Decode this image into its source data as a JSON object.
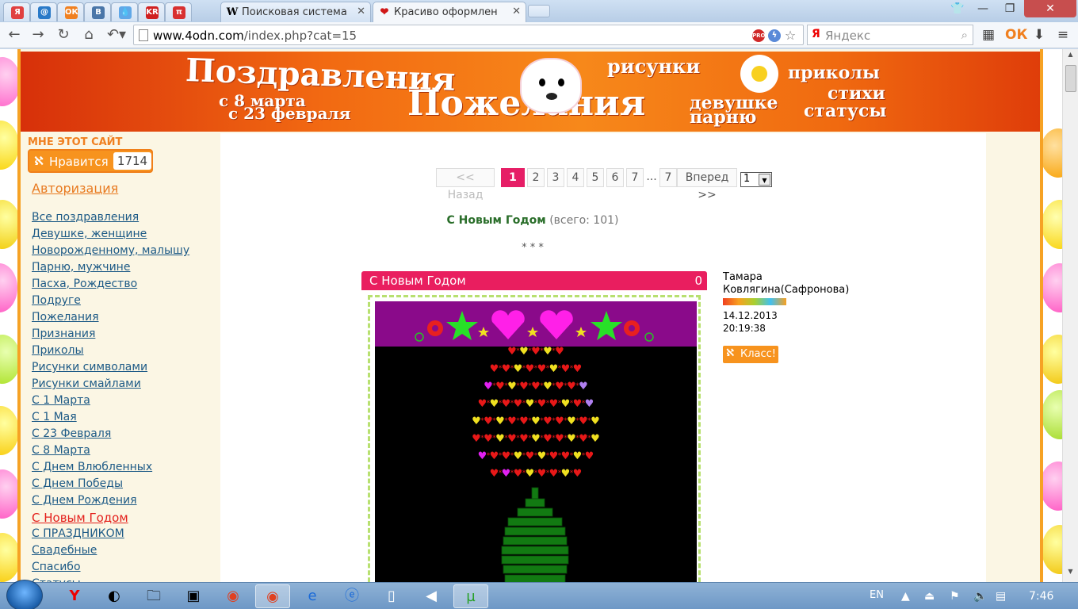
{
  "browser": {
    "pinned_tabs": [
      {
        "icon": "yandex-icon",
        "glyph": "Я",
        "color": "#e04040"
      },
      {
        "icon": "mail-icon",
        "glyph": "@",
        "color": "#2a7ac8"
      },
      {
        "icon": "odnoklassniki-icon",
        "glyph": "ОК",
        "color": "#f08020"
      },
      {
        "icon": "vk-icon",
        "glyph": "В",
        "color": "#4a76a8"
      },
      {
        "icon": "drop-icon",
        "glyph": "💧",
        "color": "#60a8e8"
      },
      {
        "icon": "kr-icon",
        "glyph": "KR",
        "color": "#d02020"
      },
      {
        "icon": "pi-icon",
        "glyph": "π",
        "color": "#d83030"
      }
    ],
    "tabs": [
      {
        "title": "Поисковая система",
        "favicon": "W",
        "active": false
      },
      {
        "title": "Красиво оформлен",
        "favicon": "❤",
        "active": true
      }
    ],
    "url_domain": "www.4odn.com",
    "url_path": "/index.php?cat=15",
    "search_placeholder": "Яндекс"
  },
  "site": {
    "banner": {
      "title1": "Поздравления",
      "subtitle1": "с 8 марта",
      "subtitle2": "с 23 февраля",
      "title2": "Пожелания",
      "words": [
        "рисунки",
        "приколы",
        "девушке",
        "стихи",
        "парню",
        "статусы"
      ]
    },
    "like_caption": "МНЕ ЭТОТ САЙТ",
    "like_label": "Нравится",
    "like_count": "1714",
    "auth_link": "Авторизация",
    "menu": [
      "Все поздравления",
      "Девушке, женщине",
      "Новорожденному, малышу",
      "Парню, мужчине",
      "Пасха, Рождество",
      "Подруге",
      "Пожелания",
      "Признания",
      "Приколы",
      "Рисунки символами",
      "Рисунки смайлами",
      "С 1 Марта",
      "С 1 Мая",
      "С 23 Февраля",
      "С 8 Марта",
      "С Днем Влюбленных",
      "С Днем Победы",
      "С Днем Рождения",
      "С Новым Годом",
      "С ПРАЗДНИКОМ",
      "Свадебные",
      "Спасибо",
      "Статусы"
    ],
    "menu_current_index": 18,
    "pager": {
      "prev": "<< Назад",
      "pages": [
        "1",
        "2",
        "3",
        "4",
        "5",
        "6",
        "7",
        "...",
        "7"
      ],
      "current": "1",
      "next": "Вперед >>",
      "select_value": "1"
    },
    "category": {
      "name": "С Новым Годом",
      "count_text": "(всего: 101)"
    },
    "separator": "* * *",
    "post": {
      "title": "С Новым Годом",
      "comments": "0",
      "author_line1": "Тамара",
      "author_line2": "Ковлягина(Сафронова)",
      "date": "14.12.2013",
      "time": "20:19:38",
      "klass_label": "Класс!"
    }
  },
  "taskbar": {
    "apps": [
      "yandex-browser",
      "winamp",
      "explorer",
      "media-player",
      "chrome",
      "chrome-active",
      "ie",
      "ie2",
      "notepad",
      "volume",
      "utorrent"
    ],
    "lang": "EN",
    "clock": "7:46"
  }
}
